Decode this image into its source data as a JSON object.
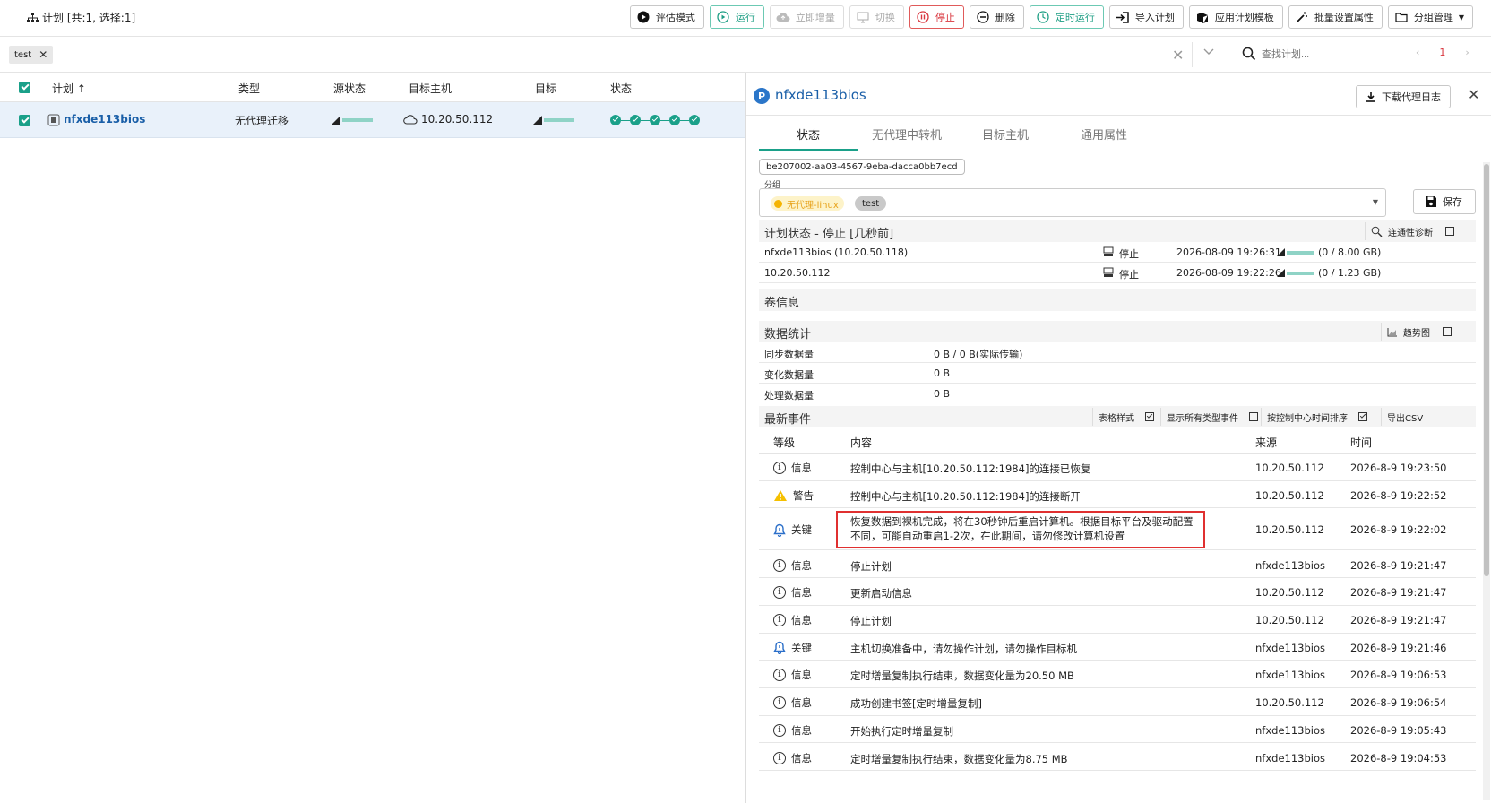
{
  "header": {
    "title": "计划 [共:1, 选择:1]",
    "buttons": {
      "evaluate": "评估模式",
      "run": "运行",
      "increment": "立即增量",
      "switch": "切换",
      "stop": "停止",
      "delete": "删除",
      "scheduled": "定时运行",
      "import": "导入计划",
      "template": "应用计划模板",
      "batch": "批量设置属性",
      "group": "分组管理"
    }
  },
  "filter": {
    "tag": "test",
    "search_placeholder": "查找计划...",
    "page": "1"
  },
  "table": {
    "columns": {
      "plan": "计划",
      "type": "类型",
      "source_status": "源状态",
      "target_host": "目标主机",
      "target": "目标",
      "status": "状态"
    },
    "rows": [
      {
        "name": "nfxde113bios",
        "type": "无代理迁移",
        "target_host": "10.20.50.112"
      }
    ]
  },
  "panel": {
    "title": "nfxde113bios",
    "logo_letter": "P",
    "download_log": "下载代理日志",
    "tabs": [
      "状态",
      "无代理中转机",
      "目标主机",
      "通用属性"
    ],
    "uuid": "be207002-aa03-4567-9eba-dacca0bb7ecd",
    "group_label": "分组",
    "group_chips": [
      "无代理-linux",
      "test"
    ],
    "save": "保存",
    "plan_status": {
      "title": "计划状态 - 停止 [几秒前]",
      "tool": "连通性诊断",
      "rows": [
        {
          "name": "nfxde113bios (10.20.50.118)",
          "state": "停止",
          "time": "2026-08-09 19:26:31",
          "size": "(0 / 8.00 GB)"
        },
        {
          "name": "10.20.50.112",
          "state": "停止",
          "time": "2026-08-09 19:22:26",
          "size": "(0 / 1.23 GB)"
        }
      ]
    },
    "volume_title": "卷信息",
    "stats": {
      "title": "数据统计",
      "tool": "趋势图",
      "rows": [
        {
          "k": "同步数据量",
          "v": "0 B / 0 B(实际传输)"
        },
        {
          "k": "变化数据量",
          "v": "0 B"
        },
        {
          "k": "处理数据量",
          "v": "0 B"
        }
      ]
    },
    "events": {
      "title": "最新事件",
      "tools": {
        "table_style": "表格样式",
        "show_all": "显示所有类型事件",
        "sort": "按控制中心时间排序",
        "export": "导出CSV"
      },
      "columns": {
        "level": "等级",
        "content": "内容",
        "source": "来源",
        "time": "时间"
      },
      "rows": [
        {
          "level": "信息",
          "kind": "info",
          "content": "控制中心与主机[10.20.50.112:1984]的连接已恢复",
          "source": "10.20.50.112",
          "time": "2026-8-9 19:23:50"
        },
        {
          "level": "警告",
          "kind": "warn",
          "content": "控制中心与主机[10.20.50.112:1984]的连接断开",
          "source": "10.20.50.112",
          "time": "2026-8-9 19:22:52"
        },
        {
          "level": "关键",
          "kind": "key",
          "content": "恢复数据到裸机完成，将在30秒钟后重启计算机。根据目标平台及驱动配置",
          "content2": "不同，可能自动重启1-2次，在此期间，请勿修改计算机设置",
          "source": "10.20.50.112",
          "time": "2026-8-9 19:22:02"
        },
        {
          "level": "信息",
          "kind": "info",
          "content": "停止计划",
          "source": "nfxde113bios",
          "time": "2026-8-9 19:21:47"
        },
        {
          "level": "信息",
          "kind": "info",
          "content": "更新启动信息",
          "source": "10.20.50.112",
          "time": "2026-8-9 19:21:47"
        },
        {
          "level": "信息",
          "kind": "info",
          "content": "停止计划",
          "source": "10.20.50.112",
          "time": "2026-8-9 19:21:47"
        },
        {
          "level": "关键",
          "kind": "key",
          "content": "主机切换准备中，请勿操作计划，请勿操作目标机",
          "source": "nfxde113bios",
          "time": "2026-8-9 19:21:46"
        },
        {
          "level": "信息",
          "kind": "info",
          "content": "定时增量复制执行结束，数据变化量为20.50 MB",
          "source": "nfxde113bios",
          "time": "2026-8-9 19:06:53"
        },
        {
          "level": "信息",
          "kind": "info",
          "content": "成功创建书签[定时增量复制]",
          "source": "10.20.50.112",
          "time": "2026-8-9 19:06:54"
        },
        {
          "level": "信息",
          "kind": "info",
          "content": "开始执行定时增量复制",
          "source": "nfxde113bios",
          "time": "2026-8-9 19:05:43"
        },
        {
          "level": "信息",
          "kind": "info",
          "content": "定时增量复制执行结束，数据变化量为8.75 MB",
          "source": "nfxde113bios",
          "time": "2026-8-9 19:04:53"
        }
      ]
    }
  }
}
